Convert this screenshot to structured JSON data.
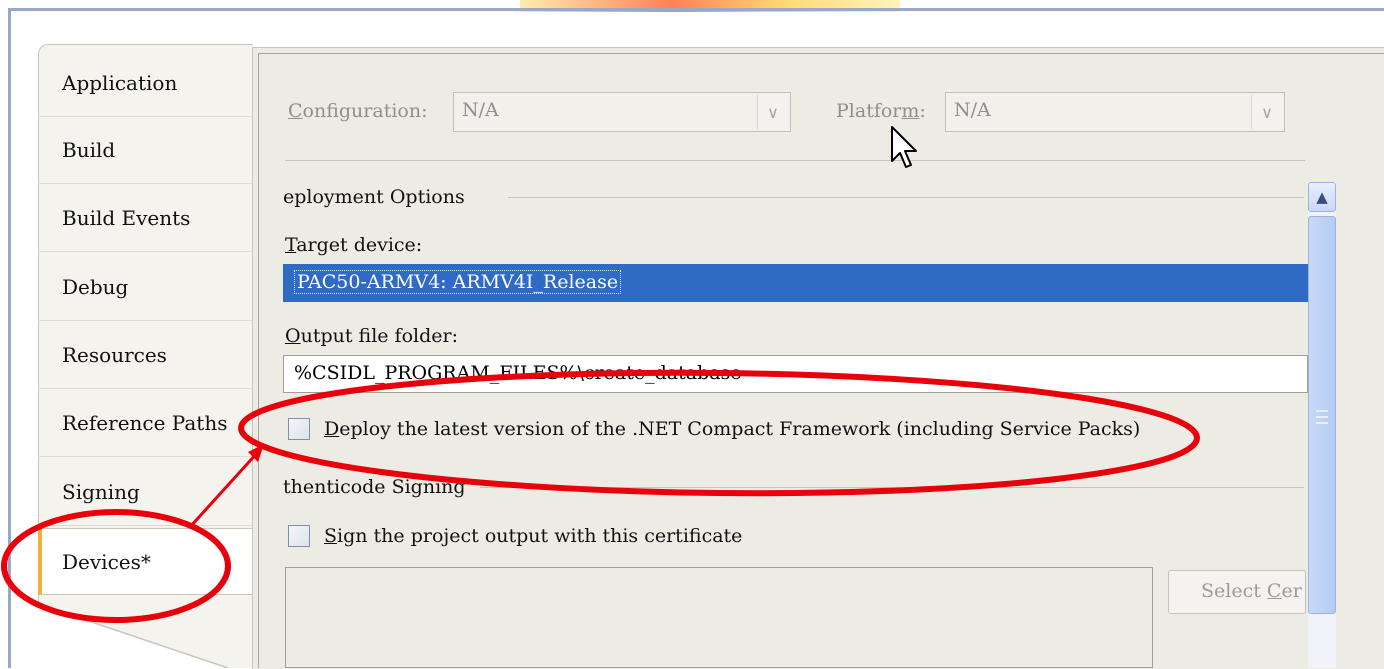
{
  "tabs": [
    {
      "label": "Application"
    },
    {
      "label": "Build"
    },
    {
      "label": "Build Events"
    },
    {
      "label": "Debug"
    },
    {
      "label": "Resources"
    },
    {
      "label": "Reference Paths"
    },
    {
      "label": "Signing"
    },
    {
      "label": "Devices*",
      "active": true
    }
  ],
  "toolbar": {
    "configuration_label_pre": "",
    "configuration_label_u": "C",
    "configuration_label_post": "onfiguration:",
    "configuration_value": "N/A",
    "platform_label_pre": "Platfor",
    "platform_label_u": "m",
    "platform_label_post": ":",
    "platform_value": "N/A"
  },
  "deployment": {
    "section_title": "eployment Options",
    "target_label_u": "T",
    "target_label_rest": "arget device:",
    "target_value": "PAC50-ARMV4: ARMV4I_Release",
    "output_label_u": "O",
    "output_label_rest": "utput file folder:",
    "output_value": "%CSIDL_PROGRAM_FILES%\\create_database",
    "deploy_cf_u": "D",
    "deploy_cf_rest": "eploy the latest version of the .NET Compact Framework (including Service Packs)"
  },
  "authenticode": {
    "section_title": "thenticode Signing",
    "sign_u": "S",
    "sign_rest": "ign the project output with this certificate",
    "select_button_pre": "Select ",
    "select_button_u": "C",
    "select_button_post": "er"
  },
  "colors": {
    "selection": "#2f6bc4",
    "annotation": "#e8000b",
    "active_tab_accent": "#f0b034"
  }
}
